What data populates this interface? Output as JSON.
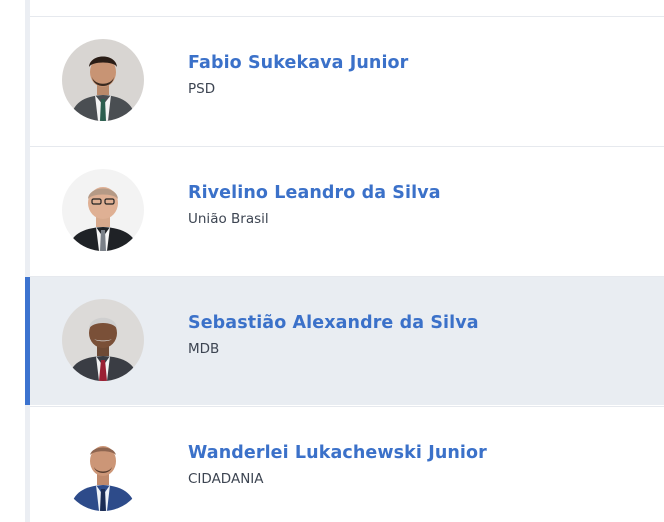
{
  "members": [
    {
      "name": "Fabio Sukekava Junior",
      "party": "PSD",
      "avatar_icon": "person-photo",
      "active": false
    },
    {
      "name": "Rivelino Leandro da Silva",
      "party": "União Brasil",
      "avatar_icon": "person-photo",
      "active": false
    },
    {
      "name": "Sebastião Alexandre da Silva",
      "party": "MDB",
      "avatar_icon": "person-photo",
      "active": true
    },
    {
      "name": "Wanderlei Lukachewski Junior",
      "party": "CIDADANIA",
      "avatar_icon": "person-photo",
      "active": false
    }
  ],
  "colors": {
    "name_link": "#3b71c9",
    "active_row_bg": "#e9edf2",
    "active_indicator": "#3c73cf",
    "party_text": "#3d4552"
  }
}
